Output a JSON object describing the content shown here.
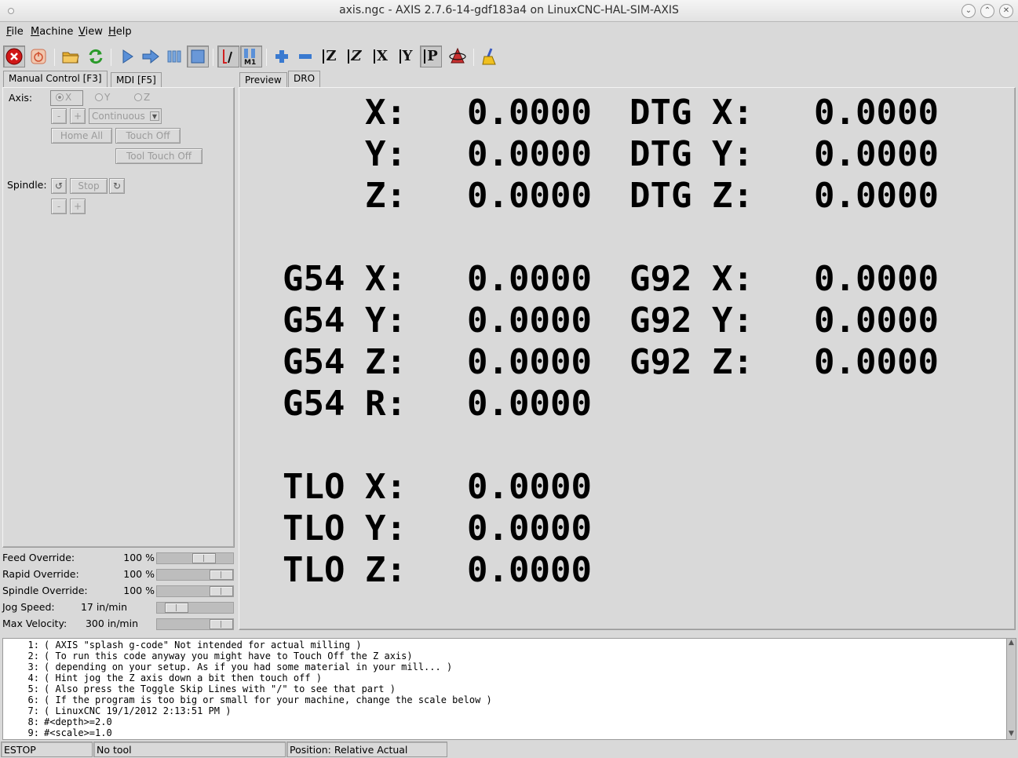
{
  "window": {
    "title": "axis.ngc - AXIS 2.7.6-14-gdf183a4 on LinuxCNC-HAL-SIM-AXIS"
  },
  "menu": [
    "File",
    "Machine",
    "View",
    "Help"
  ],
  "toolbar": {
    "axis_buttons": [
      "Z",
      "Z",
      "X",
      "Y",
      "P"
    ]
  },
  "left_tabs": [
    "Manual Control [F3]",
    "MDI [F5]"
  ],
  "manual": {
    "axis_label": "Axis:",
    "axes": [
      "X",
      "Y",
      "Z"
    ],
    "selected_axis": "X",
    "jog_minus": "-",
    "jog_plus": "+",
    "jog_mode": "Continuous",
    "home_all": "Home All",
    "touch_off": "Touch Off",
    "tool_touch_off": "Tool Touch Off",
    "spindle_label": "Spindle:",
    "spindle_stop": "Stop",
    "spindle_minus": "-",
    "spindle_plus": "+"
  },
  "overrides": [
    {
      "label": "Feed Override:",
      "value": "100 %",
      "level": 0.67
    },
    {
      "label": "Rapid Override:",
      "value": "100 %",
      "level": 1.0
    },
    {
      "label": "Spindle Override:",
      "value": "100 %",
      "level": 1.0
    },
    {
      "label": "Jog Speed:",
      "value": "17 in/min",
      "level": 0.15
    },
    {
      "label": "Max Velocity:",
      "value": "300 in/min",
      "level": 1.0
    }
  ],
  "right_tabs": [
    "Preview",
    "DRO"
  ],
  "dro": {
    "rows": [
      {
        "left_prefix": "",
        "left_axis": "X:",
        "left_value": "0.0000",
        "right_prefix": "DTG",
        "right_axis": "X:",
        "right_value": "0.0000"
      },
      {
        "left_prefix": "",
        "left_axis": "Y:",
        "left_value": "0.0000",
        "right_prefix": "DTG",
        "right_axis": "Y:",
        "right_value": "0.0000"
      },
      {
        "left_prefix": "",
        "left_axis": "Z:",
        "left_value": "0.0000",
        "right_prefix": "DTG",
        "right_axis": "Z:",
        "right_value": "0.0000"
      },
      {
        "left_prefix": "G54",
        "left_axis": "X:",
        "left_value": "0.0000",
        "right_prefix": "G92",
        "right_axis": "X:",
        "right_value": "0.0000"
      },
      {
        "left_prefix": "G54",
        "left_axis": "Y:",
        "left_value": "0.0000",
        "right_prefix": "G92",
        "right_axis": "Y:",
        "right_value": "0.0000"
      },
      {
        "left_prefix": "G54",
        "left_axis": "Z:",
        "left_value": "0.0000",
        "right_prefix": "G92",
        "right_axis": "Z:",
        "right_value": "0.0000"
      },
      {
        "left_prefix": "G54",
        "left_axis": "R:",
        "left_value": "0.0000",
        "right_prefix": "",
        "right_axis": "",
        "right_value": ""
      },
      {
        "left_prefix": "TLO",
        "left_axis": "X:",
        "left_value": "0.0000",
        "right_prefix": "",
        "right_axis": "",
        "right_value": ""
      },
      {
        "left_prefix": "TLO",
        "left_axis": "Y:",
        "left_value": "0.0000",
        "right_prefix": "",
        "right_axis": "",
        "right_value": ""
      },
      {
        "left_prefix": "TLO",
        "left_axis": "Z:",
        "left_value": "0.0000",
        "right_prefix": "",
        "right_axis": "",
        "right_value": ""
      }
    ]
  },
  "gcode": [
    {
      "n": "1:",
      "text": "( AXIS \"splash g-code\" Not intended for actual milling )"
    },
    {
      "n": "2:",
      "text": "( To run this code anyway you might have to Touch Off the Z axis)"
    },
    {
      "n": "3:",
      "text": "( depending on your setup. As if you had some material in your mill... )"
    },
    {
      "n": "4:",
      "text": "( Hint jog the Z axis down a bit then touch off )"
    },
    {
      "n": "5:",
      "text": "( Also press the Toggle Skip Lines with \"/\" to see that part )"
    },
    {
      "n": "6:",
      "text": "( If the program is too big or small for your machine, change the scale below )"
    },
    {
      "n": "7:",
      "text": "( LinuxCNC 19/1/2012 2:13:51 PM )"
    },
    {
      "n": "8:",
      "text": "#<depth>=2.0"
    },
    {
      "n": "9:",
      "text": "#<scale>=1.0"
    }
  ],
  "status": {
    "machine": "ESTOP",
    "tool": "No tool",
    "position": "Position: Relative Actual"
  }
}
